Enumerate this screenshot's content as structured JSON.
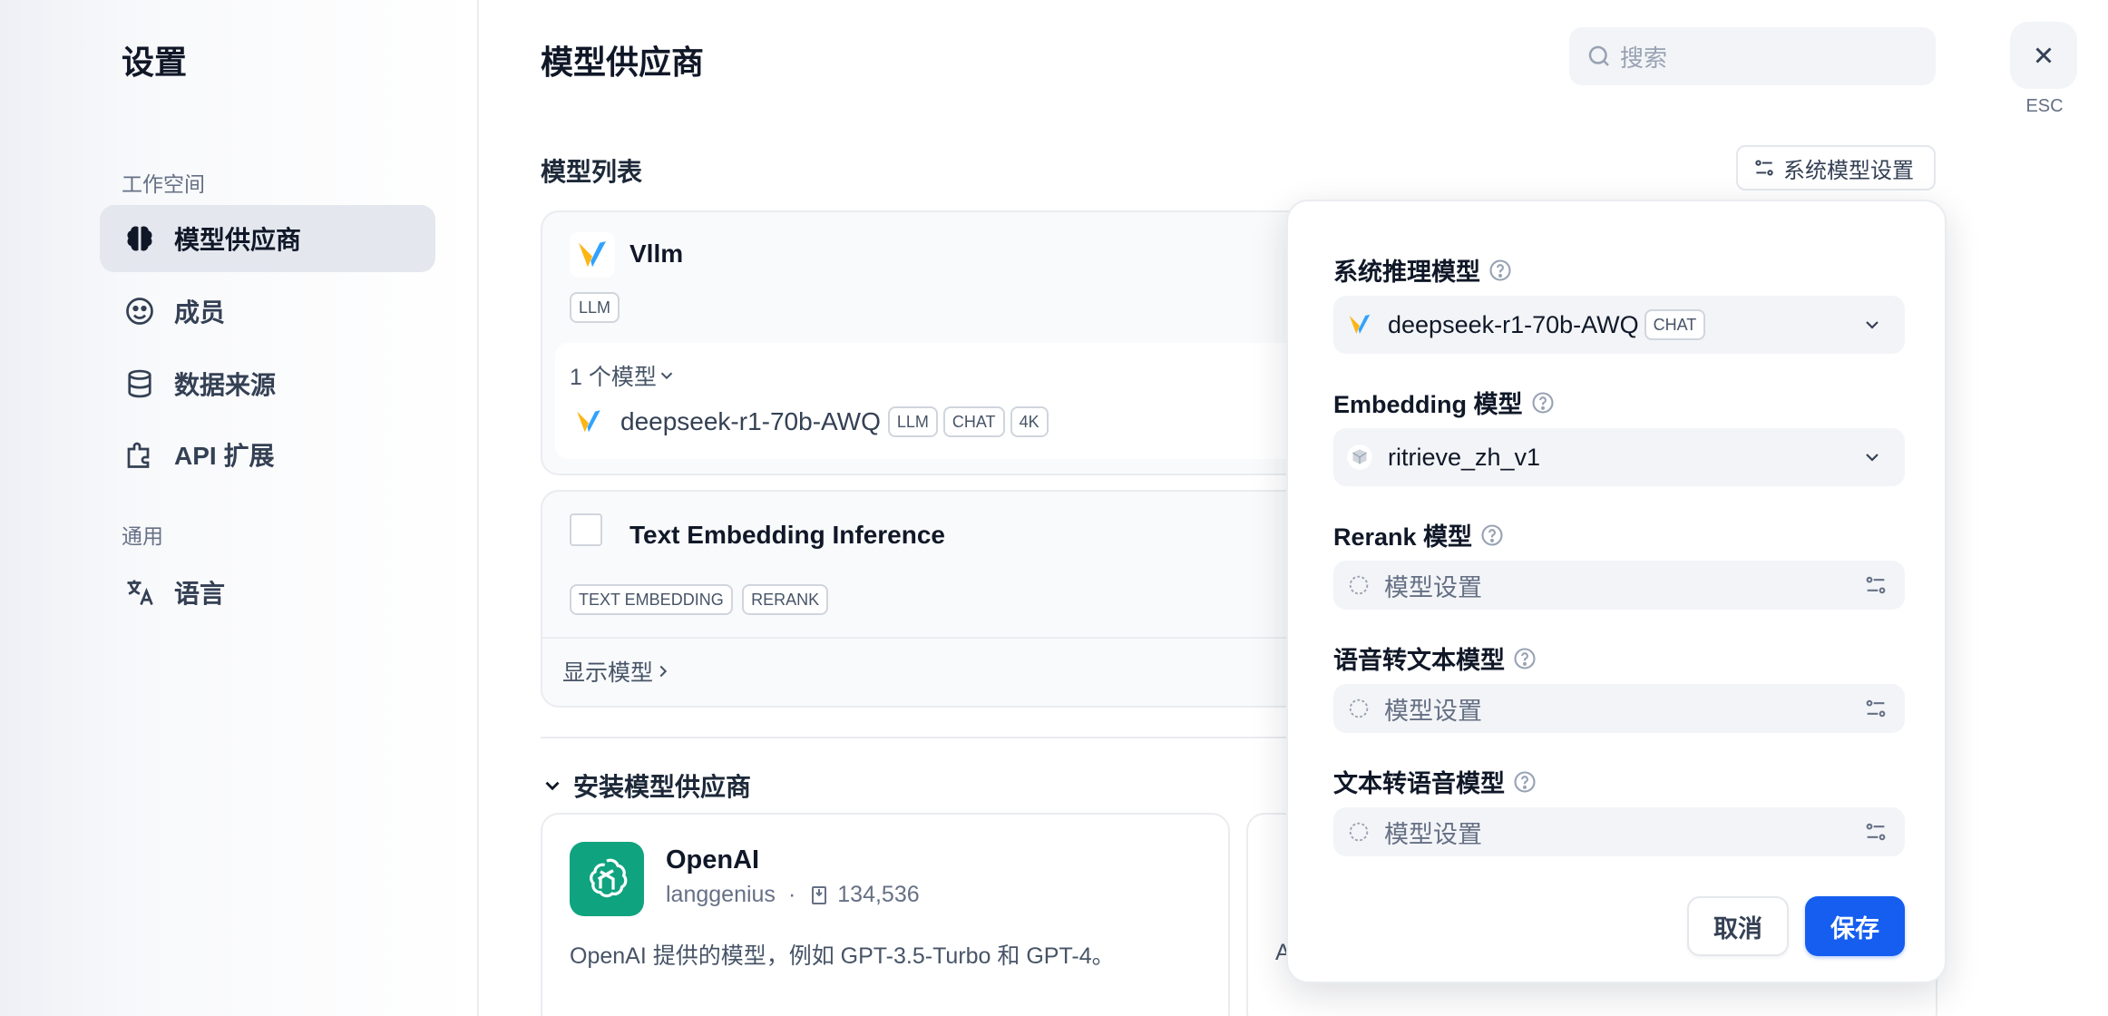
{
  "sidebar": {
    "title": "设置",
    "workspace_label": "工作空间",
    "general_label": "通用",
    "items": [
      {
        "label": "模型供应商",
        "icon": "brain-icon"
      },
      {
        "label": "成员",
        "icon": "members-icon"
      },
      {
        "label": "数据来源",
        "icon": "database-icon"
      },
      {
        "label": "API 扩展",
        "icon": "puzzle-icon"
      },
      {
        "label": "语言",
        "icon": "translate-icon"
      }
    ]
  },
  "header": {
    "title": "模型供应商",
    "search_placeholder": "搜索",
    "esc_label": "ESC"
  },
  "model_list": {
    "title": "模型列表",
    "system_settings_label": "系统模型设置"
  },
  "providers": [
    {
      "name": "Vllm",
      "tags": [
        "LLM"
      ],
      "model_count_label": "1 个模型",
      "models": [
        {
          "name": "deepseek-r1-70b-AWQ",
          "tags": [
            "LLM",
            "CHAT",
            "4K"
          ]
        }
      ]
    },
    {
      "name": "Text Embedding Inference",
      "tags": [
        "TEXT EMBEDDING",
        "RERANK"
      ],
      "show_models_label": "显示模型"
    }
  ],
  "install": {
    "title": "安装模型供应商",
    "cards": [
      {
        "name": "OpenAI",
        "author": "langgenius",
        "installs": "134,536",
        "description": "OpenAI 提供的模型，例如 GPT-3.5-Turbo 和 GPT-4。"
      },
      {
        "description": "A"
      }
    ]
  },
  "system_model_panel": {
    "fields": [
      {
        "label": "系统推理模型",
        "value": "deepseek-r1-70b-AWQ",
        "badge": "CHAT"
      },
      {
        "label": "Embedding 模型",
        "value": "ritrieve_zh_v1"
      },
      {
        "label": "Rerank 模型",
        "placeholder": "模型设置"
      },
      {
        "label": "语音转文本模型",
        "placeholder": "模型设置"
      },
      {
        "label": "文本转语音模型",
        "placeholder": "模型设置"
      }
    ],
    "cancel_label": "取消",
    "save_label": "保存"
  },
  "colors": {
    "primary": "#155eef",
    "openai": "#10a37f",
    "vllm_blue": "#30a2ff",
    "vllm_yellow": "#fdb515"
  }
}
